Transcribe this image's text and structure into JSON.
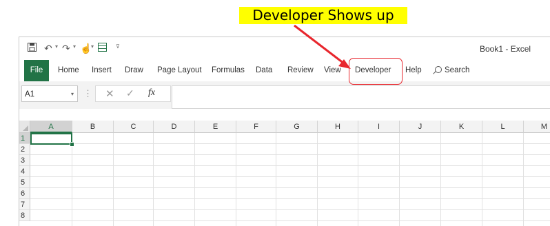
{
  "annotation": {
    "callout_text": "Developer Shows up",
    "arrow_color": "#e8262d",
    "highlight_color": "#ffff00"
  },
  "window": {
    "title": "Book1  -  Excel"
  },
  "quick_access": [
    "save-icon",
    "undo-icon",
    "redo-icon",
    "touch-mode-icon",
    "form-icon",
    "customize-icon"
  ],
  "ribbon": {
    "file_label": "File",
    "tabs": [
      "Home",
      "Insert",
      "Draw",
      "Page Layout",
      "Formulas",
      "Data",
      "Review",
      "View",
      "Developer",
      "Help"
    ],
    "search_label": "Search",
    "accent_color": "#217346"
  },
  "formula_bar": {
    "name_box_value": "A1",
    "fx_label": "fx",
    "formula_value": ""
  },
  "sheet": {
    "columns": [
      "A",
      "B",
      "C",
      "D",
      "E",
      "F",
      "G",
      "H",
      "I",
      "J",
      "K",
      "L",
      "M"
    ],
    "rows": [
      "1",
      "2",
      "3",
      "4",
      "5",
      "6",
      "7",
      "8"
    ],
    "active_cell": "A1"
  }
}
